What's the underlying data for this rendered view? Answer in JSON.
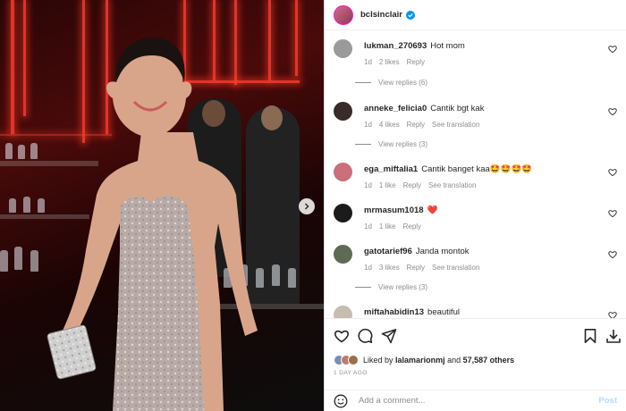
{
  "post": {
    "author": "bclsinclair",
    "colors": {
      "accent": "#0095f6",
      "verified": "#0095f6",
      "post_disabled": "#b3dbff",
      "heart_red": "#ed4956"
    }
  },
  "comments": [
    {
      "user": "lukman_270693",
      "text": "Hot mom",
      "time": "1d",
      "likes": "2 likes",
      "reply": "Reply",
      "translate": "",
      "replies": "View replies (6)",
      "avatar_color": "#9a9a9a"
    },
    {
      "user": "anneke_felicia0",
      "text": "Cantik bgt kak",
      "time": "1d",
      "likes": "4 likes",
      "reply": "Reply",
      "translate": "See translation",
      "replies": "View replies (3)",
      "avatar_color": "#3a2a2a"
    },
    {
      "user": "ega_miftalia1",
      "text": "Cantik banget kaa🤩🤩🤩🤩",
      "time": "1d",
      "likes": "1 like",
      "reply": "Reply",
      "translate": "See translation",
      "replies": "",
      "avatar_color": "#c9707a"
    },
    {
      "user": "mrmasum1018",
      "text": "❤️",
      "time": "1d",
      "likes": "1 like",
      "reply": "Reply",
      "translate": "",
      "replies": "",
      "avatar_color": "#1b1b1b"
    },
    {
      "user": "gatotarief96",
      "text": "Janda montok",
      "time": "1d",
      "likes": "3 likes",
      "reply": "Reply",
      "translate": "See translation",
      "replies": "View replies (3)",
      "avatar_color": "#5f6a55"
    },
    {
      "user": "miftahabidin13",
      "text": "beautiful",
      "time": "",
      "likes": "",
      "reply": "",
      "translate": "",
      "replies": "",
      "avatar_color": "#c8bcb0"
    }
  ],
  "actions": {
    "like_icon": "heart-outline-icon",
    "comment_icon": "comment-icon",
    "share_icon": "paper-plane-icon",
    "save_icon": "bookmark-icon",
    "download_icon": "download-icon"
  },
  "likes": {
    "prefix": "Liked by",
    "liker": "lalamarionmj",
    "joiner": "and",
    "others": "57,587 others"
  },
  "time_ago": "1 DAY AGO",
  "add_comment": {
    "placeholder": "Add a comment...",
    "post_label": "Post",
    "emoji_icon": "smiley-icon"
  },
  "carousel": {
    "next_icon": "chevron-right-icon"
  }
}
